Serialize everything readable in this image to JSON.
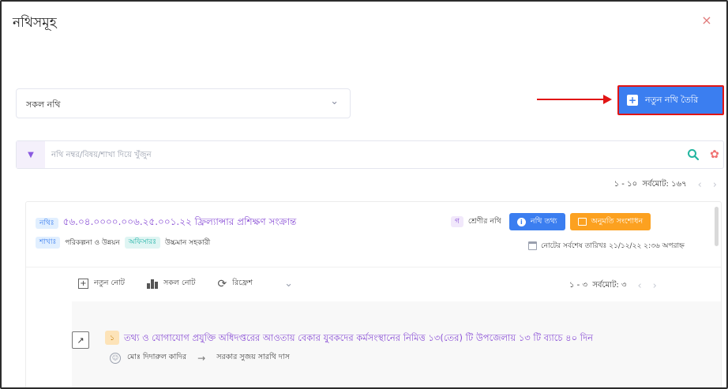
{
  "modal": {
    "title": "নথিসমূহ",
    "close_icon": "×"
  },
  "filter": {
    "selected": "সকল নথি",
    "chevron": "⌄"
  },
  "actions": {
    "new_file_label": "নতুন নথি তৈরি",
    "new_file_icon": "+"
  },
  "search": {
    "placeholder": "নথি নম্বর/বিষয়/শাখা দিয়ে খুঁজুন",
    "toggle_icon": "▼",
    "reset_icon": "✿"
  },
  "pager": {
    "range": "১ - ১০",
    "total": "সর্বমোট: ১৬৭",
    "prev": "‹",
    "next": "›"
  },
  "file": {
    "number_label": "নথিঃ",
    "number_title": "৫৬.০৪.০০০০.০০৬.২৫.০০১.২২ ফ্রিল্যান্সার প্রশিক্ষণ সংক্রান্ত",
    "branch_label": "শাখাঃ",
    "branch_value": "পরিকল্পনা ও উন্নয়ন",
    "officer_label": "অফিসারঃ",
    "officer_value": "উচ্চমান সহকারী",
    "category_tag": "গ",
    "category_text": "শ্রেণীর নথি",
    "info_button": "নথি তথ্য",
    "info_icon": "i",
    "permission_button": "অনুমতি সংশোধন",
    "last_note": "নোটের সর্বশেষ তারিখঃ ২১/১২/২২ ২:৩৬ অপরাহ্ন"
  },
  "toolbar": {
    "new_note": "নতুন নোট",
    "new_note_icon": "+",
    "all_notes": "সকল নোট",
    "refresh": "রিফ্রেশ",
    "refresh_icon": "⟳",
    "expand_icon": "⌄",
    "notes_range": "১ - ৩",
    "notes_total": "সর্বমোট: ৩"
  },
  "note": {
    "expand_icon": "↗",
    "number": "১",
    "title": "তথ্য ও যোগাযোগ প্রযুক্তি অধিদপ্তরের আওতায় বেকার যুবকদের কর্মসংস্থানের নিমিত্ত ১৩(তের) টি উপজেলায় ১৩ টি ব্যাচে ৪০ দিন",
    "user_icon": "☺",
    "from": "মোঃ দিদারুল কাদির",
    "arrow": "→",
    "to": "সরকার সুজয় সারথি দাস"
  }
}
